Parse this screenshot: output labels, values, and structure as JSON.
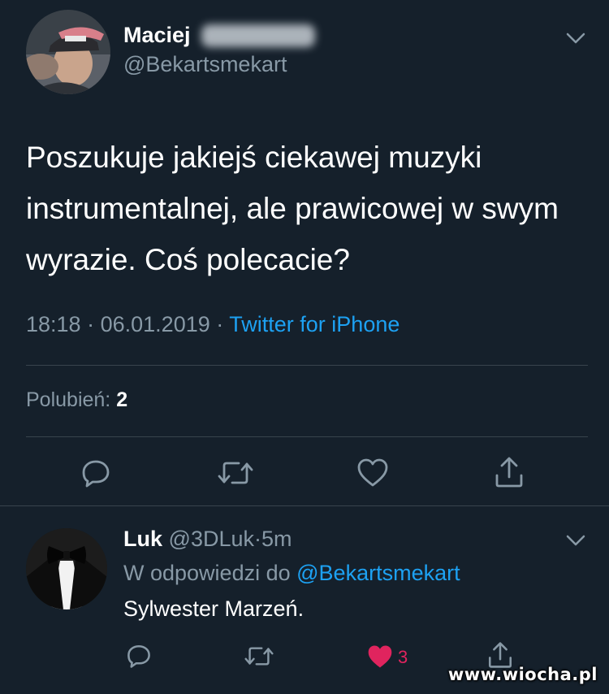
{
  "main_tweet": {
    "display_name": "Maciej",
    "handle": "@Bekartsmekart",
    "text": "Poszukuje jakiejś ciekawej muzyki instrumentalnej, ale prawicowej w swym wyrazie. Coś polecacie?",
    "time": "18:18",
    "separator": "·",
    "date": "06.01.2019",
    "source": "Twitter for iPhone",
    "likes_label": "Polubień:",
    "likes_count": "2",
    "actions": [
      "reply-icon",
      "retweet-icon",
      "like-icon",
      "share-icon"
    ]
  },
  "reply_tweet": {
    "display_name": "Luk",
    "handle": "@3DLuk",
    "separator": "·",
    "time": "5m",
    "reply_to_label": "W odpowiedzi do",
    "reply_to_handle": "@Bekartsmekart",
    "text": "Sylwester Marzeń.",
    "like_count": "3",
    "liked": true,
    "actions": [
      "reply-icon",
      "retweet-icon",
      "like-icon-filled",
      "share-icon"
    ]
  },
  "watermark": "www.wiocha.pl",
  "colors": {
    "background": "#15202b",
    "text_primary": "#ffffff",
    "text_secondary": "#8899a6",
    "link": "#1da1f2",
    "like": "#e0245e",
    "divider": "#38444d"
  }
}
